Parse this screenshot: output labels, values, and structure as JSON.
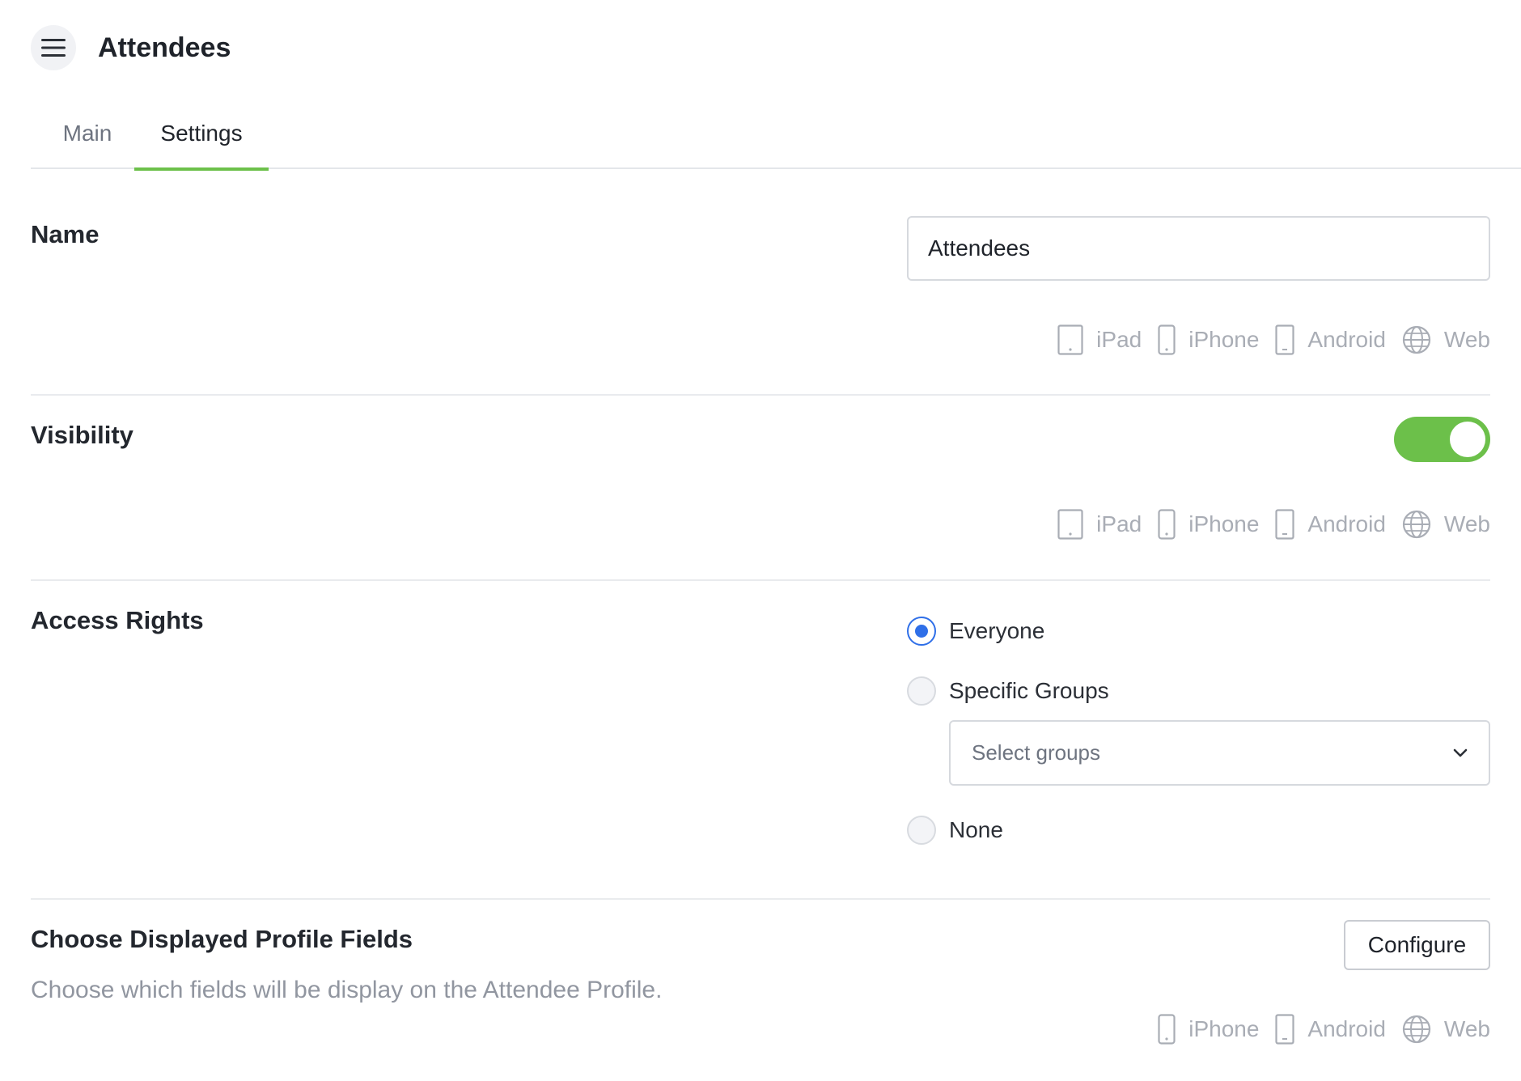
{
  "header": {
    "menu_icon": "hamburger-menu-icon",
    "title": "Attendees"
  },
  "tabs": [
    {
      "label": "Main",
      "active": false
    },
    {
      "label": "Settings",
      "active": true
    }
  ],
  "colors": {
    "accent_green": "#6cc04a",
    "radio_blue": "#2f6fe8",
    "platform_gray": "#a9adb5"
  },
  "name_section": {
    "label": "Name",
    "value": "Attendees",
    "platforms": [
      {
        "icon": "tablet-icon",
        "label": "iPad"
      },
      {
        "icon": "phone-icon",
        "label": "iPhone"
      },
      {
        "icon": "android-phone-icon",
        "label": "Android"
      },
      {
        "icon": "globe-icon",
        "label": "Web"
      }
    ]
  },
  "visibility_section": {
    "label": "Visibility",
    "enabled": true,
    "platforms": [
      {
        "icon": "tablet-icon",
        "label": "iPad"
      },
      {
        "icon": "phone-icon",
        "label": "iPhone"
      },
      {
        "icon": "android-phone-icon",
        "label": "Android"
      },
      {
        "icon": "globe-icon",
        "label": "Web"
      }
    ]
  },
  "access_section": {
    "label": "Access Rights",
    "options": [
      {
        "label": "Everyone",
        "selected": true
      },
      {
        "label": "Specific Groups",
        "selected": false
      },
      {
        "label": "None",
        "selected": false
      }
    ],
    "groups_placeholder": "Select groups"
  },
  "profile_fields_section": {
    "label": "Choose Displayed Profile Fields",
    "description": "Choose which fields will be display on the Attendee Profile.",
    "button_label": "Configure",
    "platforms": [
      {
        "icon": "phone-icon",
        "label": "iPhone"
      },
      {
        "icon": "android-phone-icon",
        "label": "Android"
      },
      {
        "icon": "globe-icon",
        "label": "Web"
      }
    ]
  }
}
